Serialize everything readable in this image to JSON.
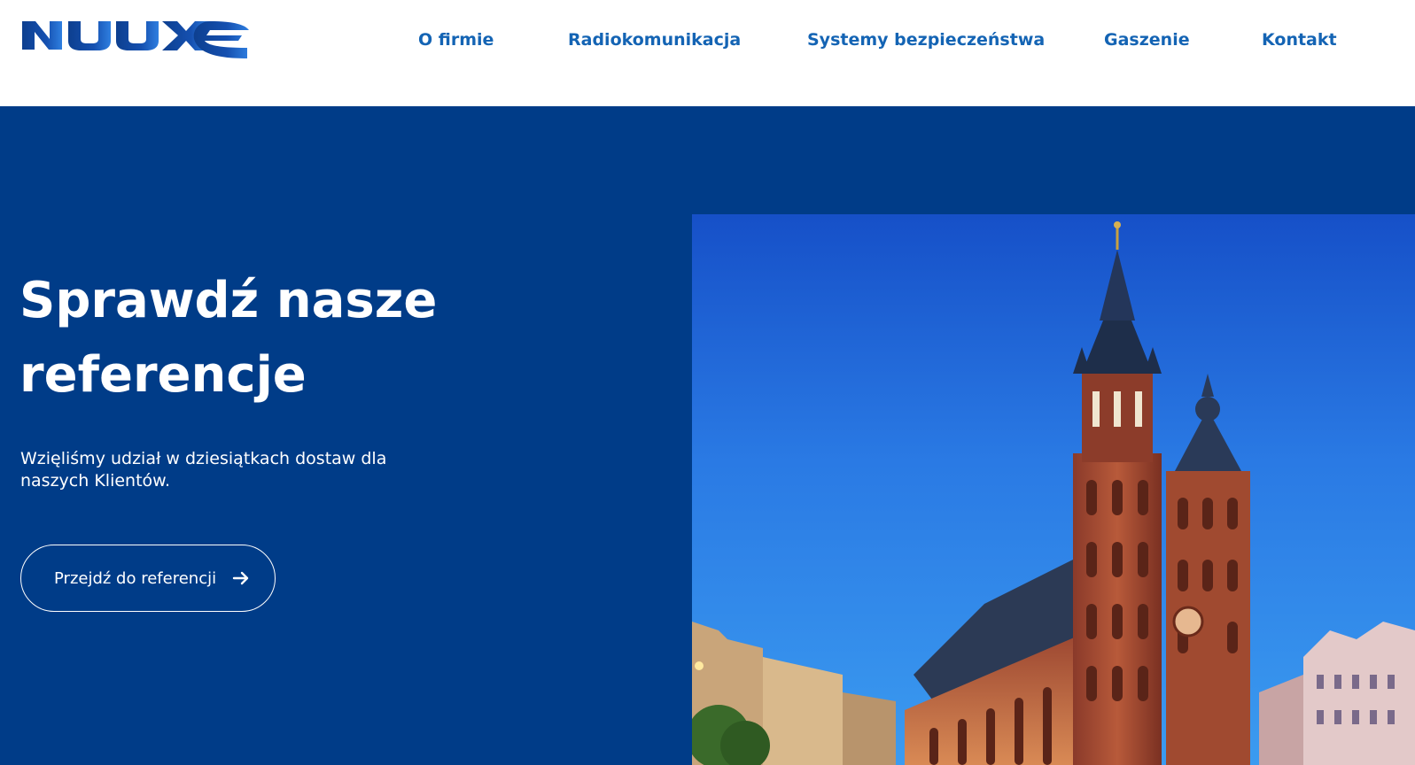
{
  "brand": {
    "logo_text": "NUUXE",
    "color": "#0f4aa2"
  },
  "nav": {
    "items": [
      {
        "label": "O firmie"
      },
      {
        "label": "Radiokomunikacja"
      },
      {
        "label": "Systemy bezpieczeństwa"
      },
      {
        "label": "Gaszenie"
      },
      {
        "label": "Kontakt"
      }
    ],
    "color": "#1464b4"
  },
  "hero": {
    "title": "Sprawdź nasze referencje",
    "subtitle": "Wzięliśmy udział w dziesiątkach dostaw dla naszych Klientów.",
    "button_label": "Przejdź do referencji",
    "button_icon": "arrow-right-icon",
    "background": "#003c88",
    "image_icon": "church-photo"
  }
}
